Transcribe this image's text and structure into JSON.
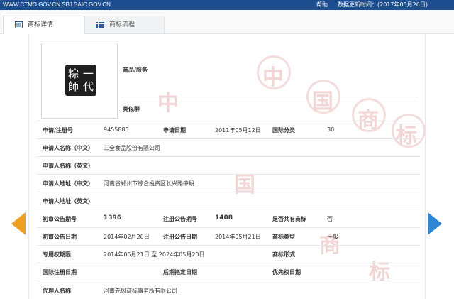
{
  "topbar": {
    "site": "WWW.CTMO.GOV.CN SBJ.SAIC.GOV.CN",
    "help": "帮助",
    "update": "数据更新时间：(2017年05月26日)"
  },
  "tabs": [
    {
      "label": "商标详情",
      "icon": "document-icon",
      "active": true
    },
    {
      "label": "商标流程",
      "icon": "list-icon",
      "active": false
    }
  ],
  "colors": {
    "topbar": "#1b4d8f",
    "prev_arrow": "#f0a020",
    "next_arrow": "#2f86d6",
    "watermark": "#f2d6d6"
  },
  "watermark_chars": [
    "中",
    "国",
    "商",
    "标",
    "中",
    "国",
    "商",
    "标"
  ],
  "trademark": {
    "image_chars": [
      "一",
      "代",
      "粽",
      "師"
    ],
    "goods_label": "商品/服务",
    "similar_group_label": "类似群"
  },
  "details": {
    "reg_no_label": "申请/注册号",
    "reg_no": "9455885",
    "app_date_label": "申请日期",
    "app_date": "2011年05月12日",
    "intl_class_label": "国际分类",
    "intl_class": "30",
    "applicant_cn_label": "申请人名称（中文）",
    "applicant_cn": "三全食品股份有限公司",
    "applicant_en_label": "申请人名称（英文）",
    "applicant_en": "",
    "address_cn_label": "申请人地址（中文）",
    "address_cn": "河南省郑州市综合投资区长兴路中段",
    "address_en_label": "申请人地址（英文）",
    "address_en": "",
    "first_pub_no_label": "初审公告期号",
    "first_pub_no": "1396",
    "reg_pub_no_label": "注册公告期号",
    "reg_pub_no": "1408",
    "shared_label": "是否共有商标",
    "shared": "否",
    "first_pub_date_label": "初审公告日期",
    "first_pub_date": "2014年02月20日",
    "reg_pub_date_label": "注册公告日期",
    "reg_pub_date": "2014年05月21日",
    "tm_type_label": "商标类型",
    "tm_type": "一般",
    "exclusive_period_label": "专用权期限",
    "exclusive_period": "2014年05月21日 至 2024年05月20日",
    "tm_form_label": "商标形式",
    "tm_form": "",
    "intl_reg_date_label": "国际注册日期",
    "intl_reg_date": "",
    "later_date_label": "后期指定日期",
    "later_date": "",
    "priority_date_label": "优先权日期",
    "priority_date": "",
    "agent_label": "代理人名称",
    "agent": "河南先风商标事务所有限公司"
  }
}
